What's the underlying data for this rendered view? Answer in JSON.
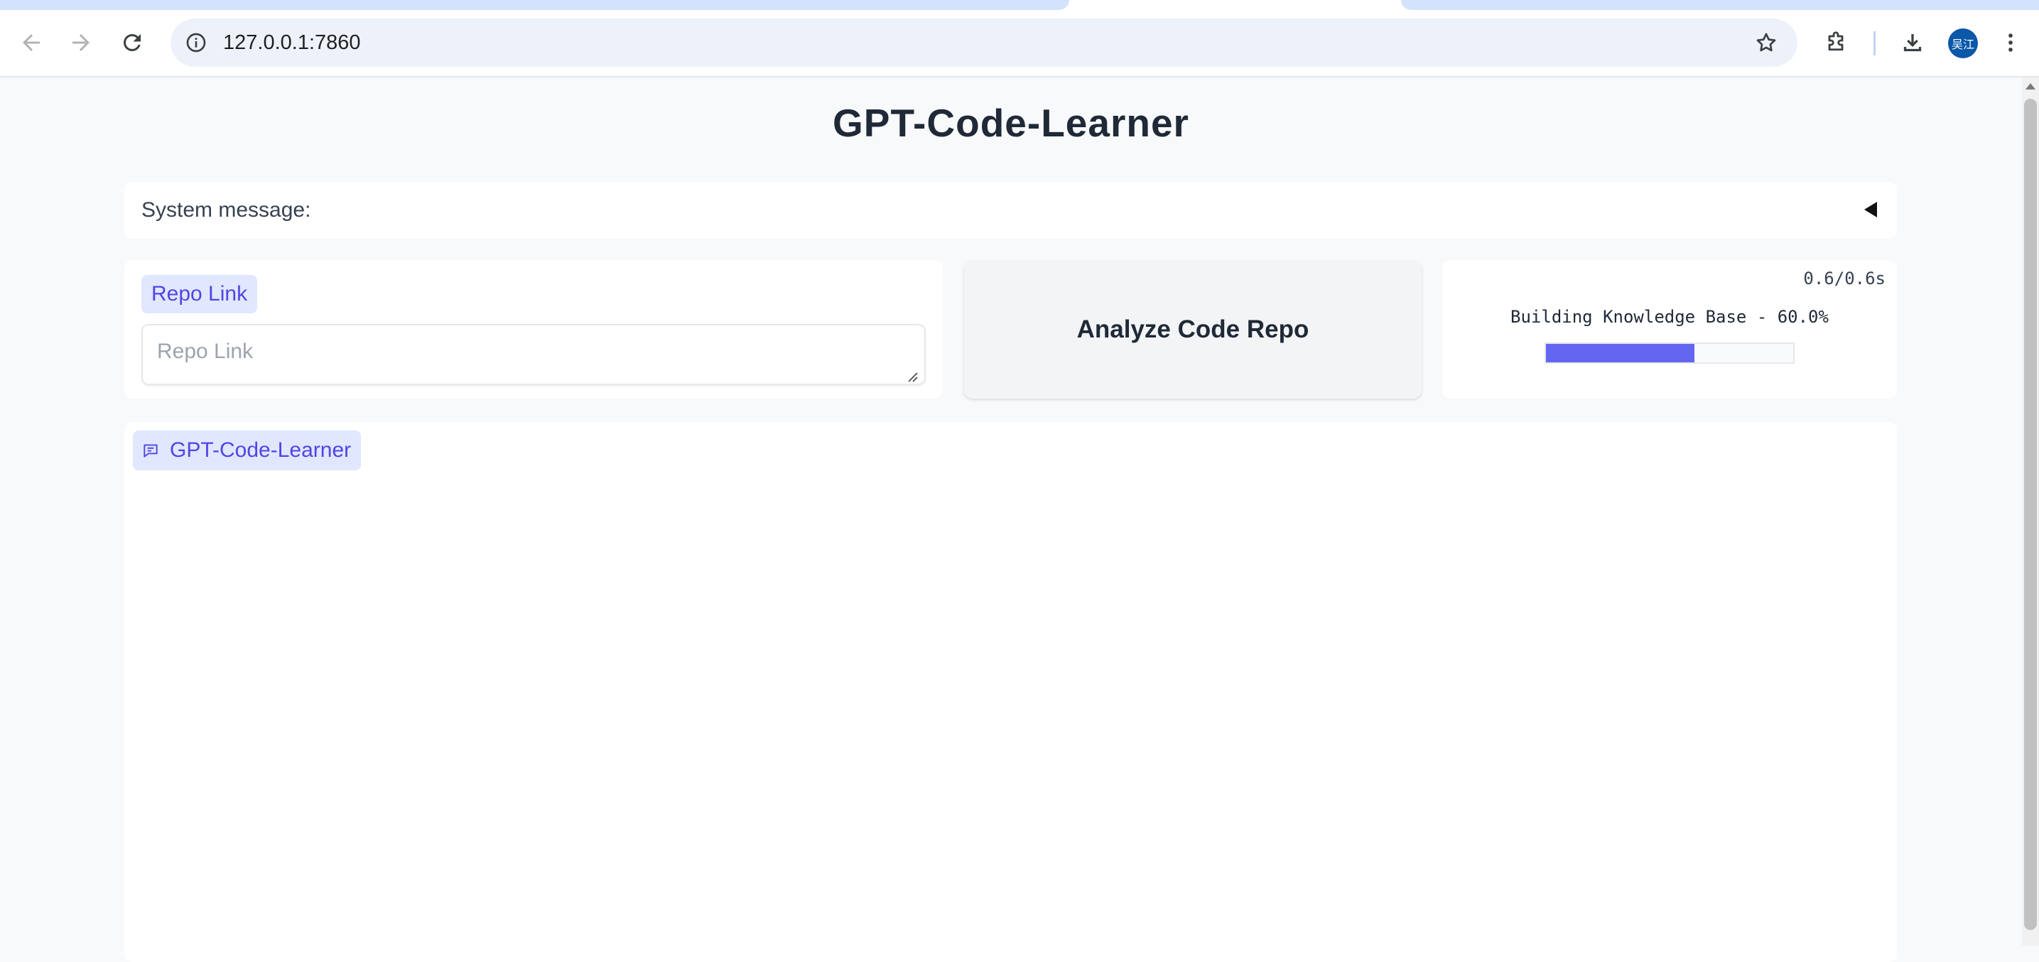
{
  "browser": {
    "url": "127.0.0.1:7860",
    "profile_initials": "吴江",
    "icons": {
      "back": "arrow-left-icon",
      "forward": "arrow-right-icon",
      "reload": "reload-icon",
      "site_info": "info-icon",
      "bookmark": "star-icon",
      "extensions": "puzzle-icon",
      "downloads": "download-icon",
      "menu": "kebab-menu-icon"
    }
  },
  "app": {
    "title": "GPT-Code-Learner",
    "system_message": {
      "label": "System message:",
      "toggle_icon": "collapse-triangle-icon"
    },
    "repo": {
      "label": "Repo Link",
      "placeholder": "Repo Link",
      "value": ""
    },
    "analyze_button": "Analyze Code Repo",
    "progress": {
      "elapsed": "0.6/0.6s",
      "text": "Building Knowledge Base - 60.0%",
      "fraction": 0.6
    },
    "chatbot": {
      "label": "GPT-Code-Learner",
      "icon": "chat-icon"
    }
  },
  "colors": {
    "accent": "#6366f1",
    "tag_bg": "#e0e7ff",
    "tag_text": "#4f46e5",
    "page_bg": "#f8f9fb"
  }
}
